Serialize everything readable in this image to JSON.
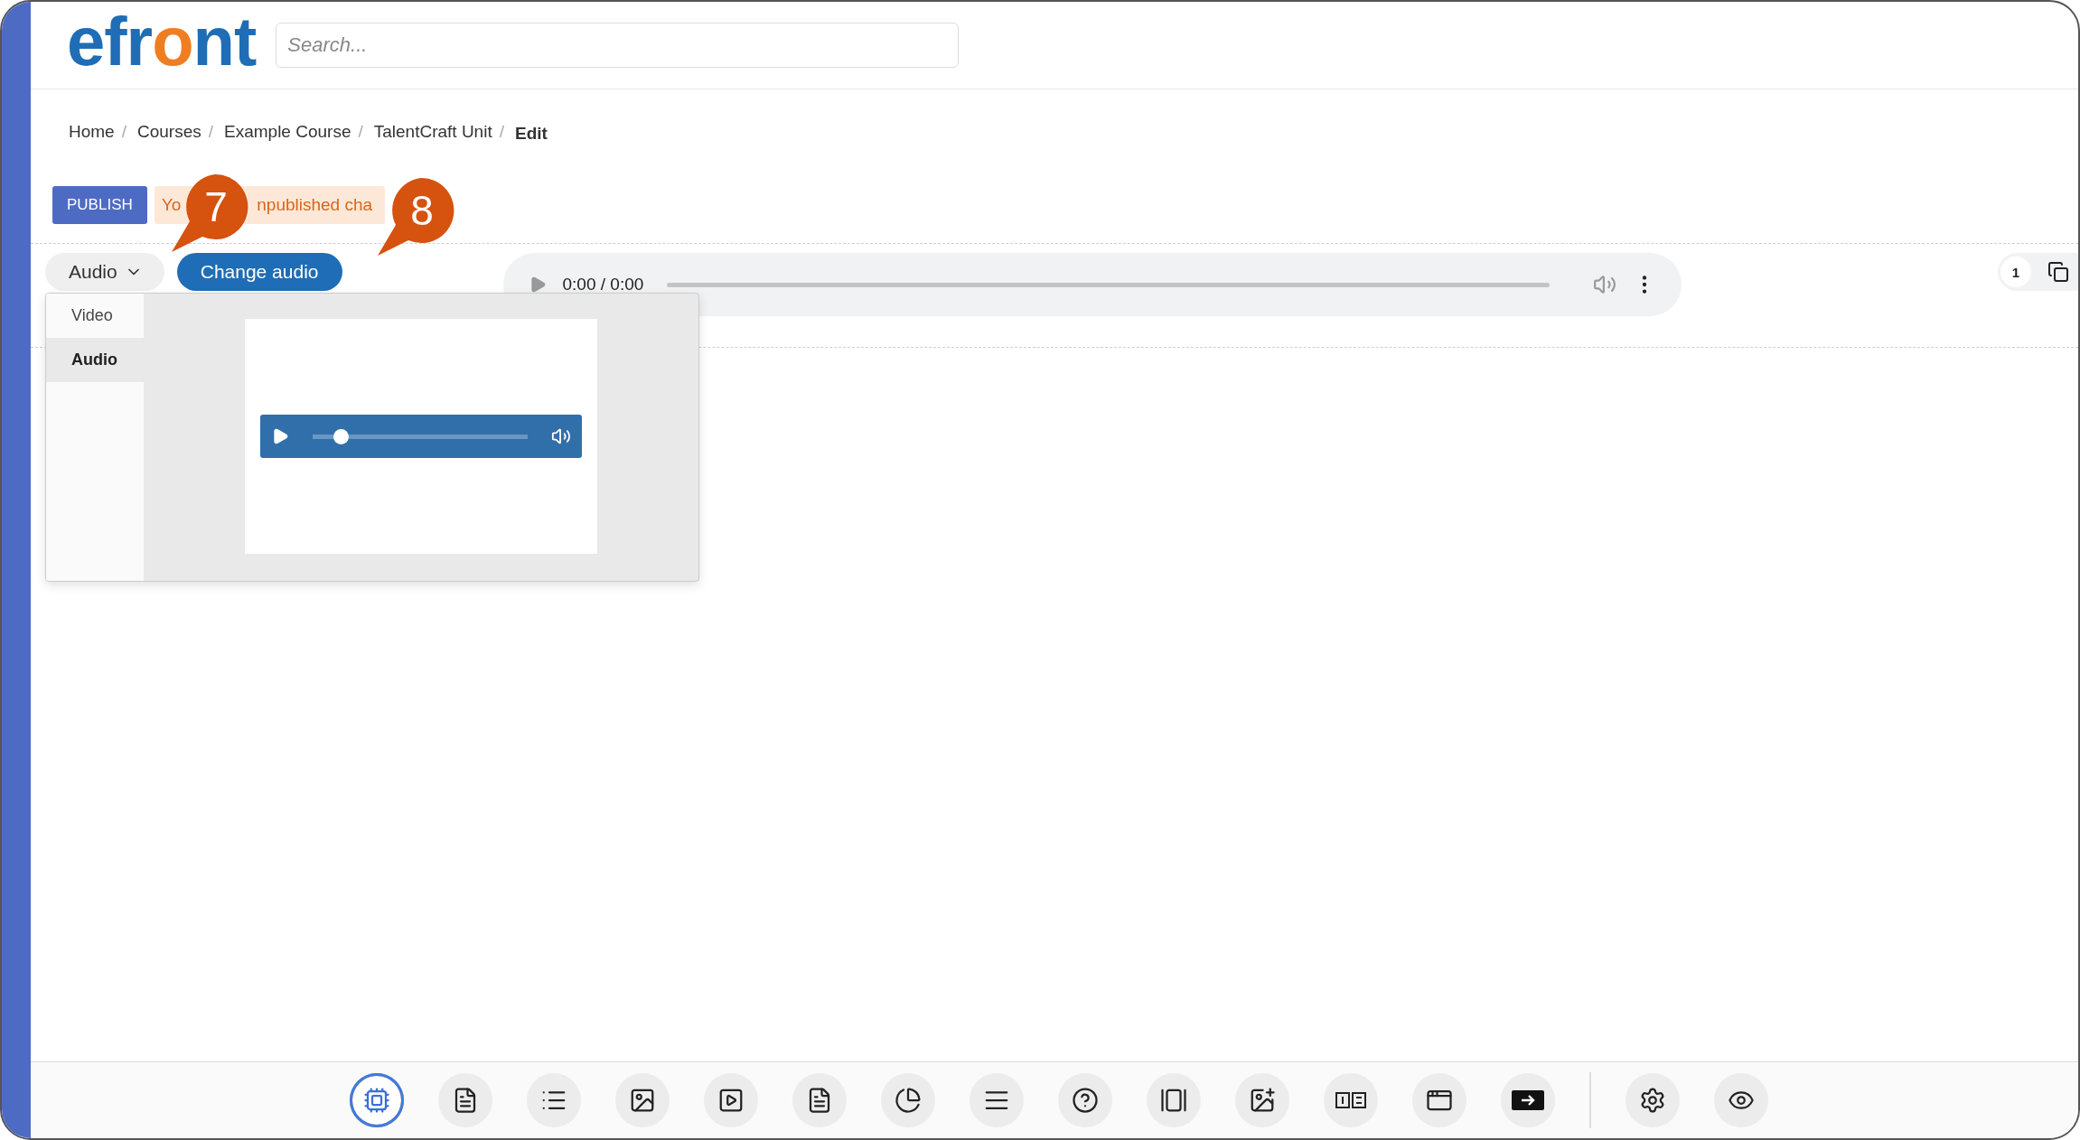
{
  "logo": {
    "parts": [
      {
        "text": "efr",
        "accent": false
      },
      {
        "text": "o",
        "accent": true
      },
      {
        "text": "nt",
        "accent": false
      }
    ]
  },
  "search": {
    "placeholder": "Search..."
  },
  "breadcrumb": [
    {
      "label": "Home",
      "current": false
    },
    {
      "label": "Courses",
      "current": false
    },
    {
      "label": "Example Course",
      "current": false
    },
    {
      "label": "TalentCraft Unit",
      "current": false
    },
    {
      "label": "Edit",
      "current": true
    }
  ],
  "breadcrumb_separator": "/",
  "publish_button": "PUBLISH",
  "notice_parts": [
    "Yo",
    "npublished cha"
  ],
  "callouts": [
    "7",
    "8"
  ],
  "media_select": {
    "value": "Audio",
    "options": [
      {
        "label": "Video",
        "selected": false
      },
      {
        "label": "Audio",
        "selected": true
      }
    ]
  },
  "change_button": "Change audio",
  "player": {
    "time": "0:00 / 0:00"
  },
  "preview_player": {
    "level": 0.13
  },
  "page_counter": "1",
  "toolbar": [
    {
      "kind": "ai"
    },
    {
      "kind": "text"
    },
    {
      "kind": "list"
    },
    {
      "kind": "image"
    },
    {
      "kind": "video"
    },
    {
      "kind": "document"
    },
    {
      "kind": "chart"
    },
    {
      "kind": "lines"
    },
    {
      "kind": "question"
    },
    {
      "kind": "cards"
    },
    {
      "kind": "image-add"
    },
    {
      "kind": "columns"
    },
    {
      "kind": "window"
    },
    {
      "kind": "embed"
    },
    {
      "kind": "separator"
    },
    {
      "kind": "settings"
    },
    {
      "kind": "preview"
    }
  ]
}
